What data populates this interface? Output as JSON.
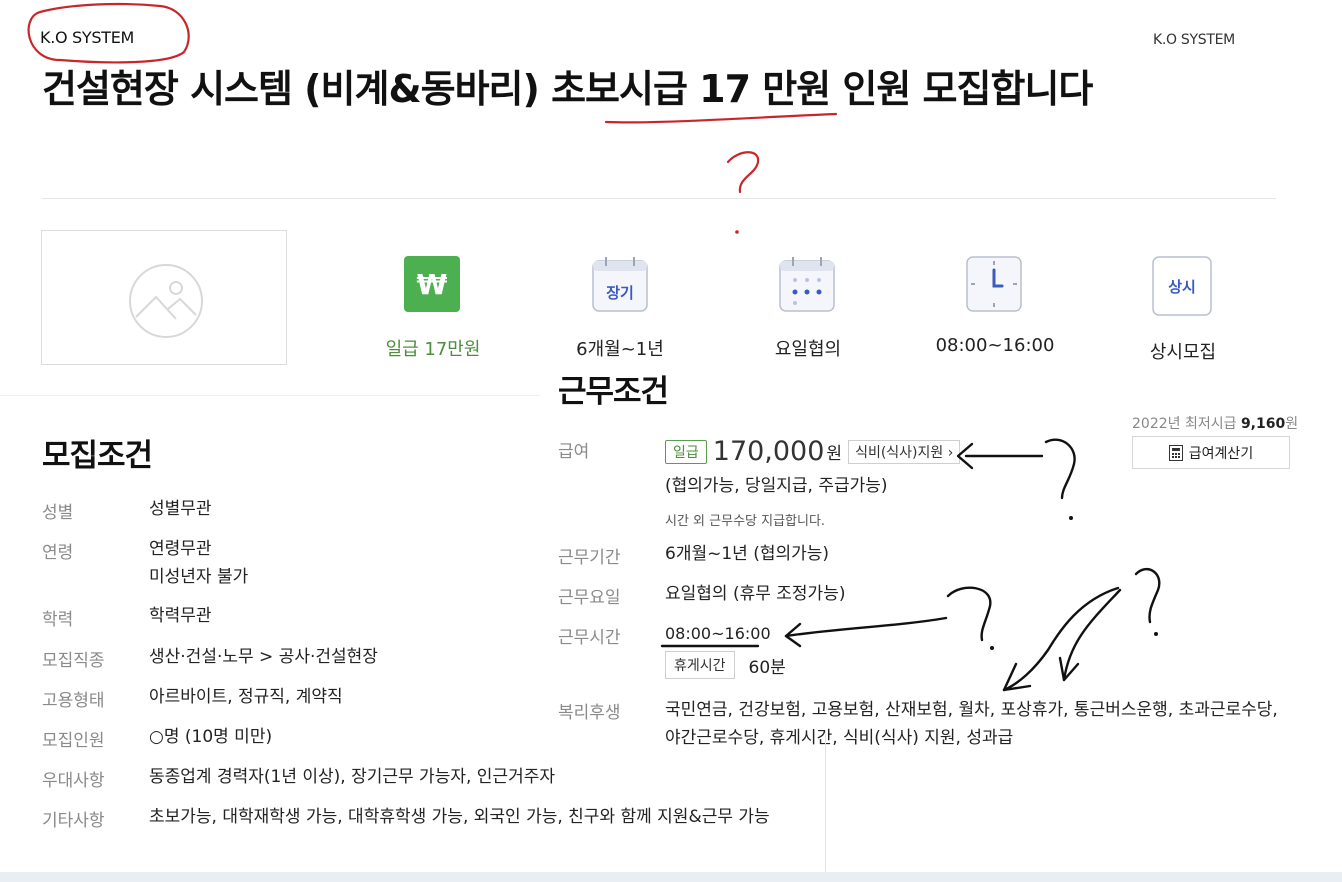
{
  "header": {
    "company": "K.O SYSTEM",
    "company_right": "K.O SYSTEM",
    "title": "건설현장 시스템 (비계&동바리) 초보시급 17 만원 인원 모집합니다"
  },
  "summary": [
    {
      "icon": "won-icon",
      "text": "₩",
      "label": "일급 17만원"
    },
    {
      "icon": "calendar-long-term-icon",
      "text": "장기",
      "label": "6개월~1년"
    },
    {
      "icon": "calendar-dots-icon",
      "label": "요일협의"
    },
    {
      "icon": "clock-icon",
      "label": "08:00~16:00"
    },
    {
      "icon": "always-recruit-icon",
      "text": "상시",
      "label": "상시모집"
    }
  ],
  "work": {
    "title": "근무조건",
    "min_wage_label": "2022년 최저시급",
    "min_wage_value": "9,160",
    "min_wage_unit": "원",
    "calc_button": "급여계산기",
    "pay_label": "급여",
    "pay_tag": "일급",
    "pay_amount": "170,000",
    "pay_unit": "원",
    "meal_tag": "식비(식사)지원",
    "pay_note": "(협의가능, 당일지급, 주급가능)",
    "pay_extra": "시간 외 근무수당 지급합니다.",
    "period_label": "근무기간",
    "period_value": "6개월~1년 (협의가능)",
    "days_label": "근무요일",
    "days_value": "요일협의 (휴무 조정가능)",
    "hours_label": "근무시간",
    "hours_value": "08:00~16:00",
    "break_tag": "휴게시간",
    "break_value": "60분",
    "benefits_label": "복리후생",
    "benefits_value": "국민연금, 건강보험, 고용보험, 산재보험, 월차, 포상휴가, 통근버스운행, 초과근로수당, 야간근로수당, 휴게시간, 식비(식사) 지원, 성과급"
  },
  "recruit": {
    "title": "모집조건",
    "rows": [
      {
        "label": "성별",
        "value": "성별무관"
      },
      {
        "label": "연령",
        "value": "연령무관",
        "value2": "미성년자 불가"
      },
      {
        "label": "학력",
        "value": "학력무관"
      },
      {
        "label": "모집직종",
        "value": "생산·건설·노무 > 공사·건설현장"
      },
      {
        "label": "고용형태",
        "value": "아르바이트, 정규직, 계약직"
      },
      {
        "label": "모집인원",
        "value": "○명 (10명 미만)"
      },
      {
        "label": "우대사항",
        "value": "동종업계 경력자(1년 이상), 장기근무 가능자, 인근거주자"
      },
      {
        "label": "기타사항",
        "value": "초보가능, 대학재학생 가능, 대학휴학생 가능, 외국인 가능, 친구와 함께 지원&근무 가능"
      }
    ]
  },
  "colors": {
    "green": "#4caf50",
    "green_text": "#4a8f3a",
    "blue_icon": "#3b5bbf",
    "red_annotation": "#c8262a"
  }
}
